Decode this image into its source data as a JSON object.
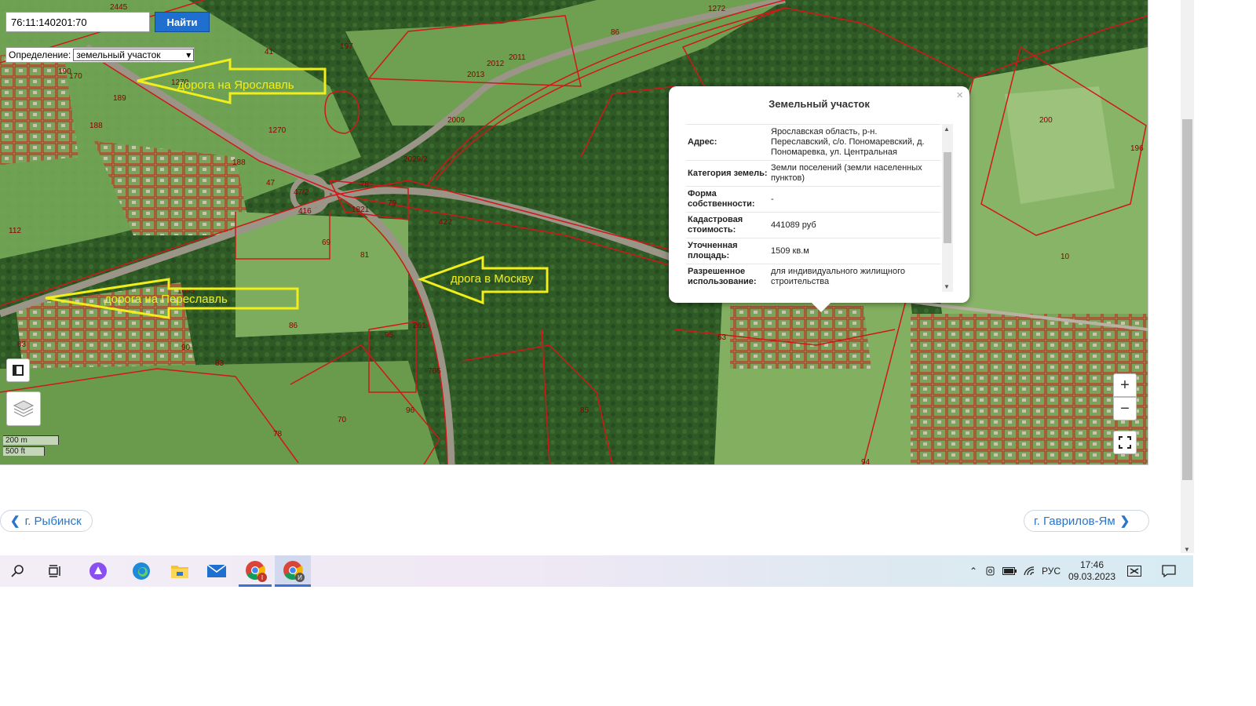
{
  "search": {
    "value": "76:11:140201:70",
    "button_label": "Найти"
  },
  "definition": {
    "label": "Определение:",
    "selected": "земельный участок"
  },
  "annotations": {
    "yaroslavl": "дорога на Ярославль",
    "pereslavl": "дорога на Переславль",
    "moscow": "дрога в Москву"
  },
  "plot_numbers": [
    "2445",
    "1272",
    "86",
    "197",
    "41",
    "2012",
    "2011",
    "190",
    "170",
    "1270",
    "2013",
    "189",
    "188",
    "1270",
    "2009",
    "2029/2",
    "200",
    "196",
    "188",
    "47",
    "47/2",
    "78",
    "1821",
    "79",
    "416",
    "112",
    "422",
    "69",
    "81",
    "10",
    "1695",
    "95",
    "83",
    "86",
    "90",
    "63",
    "261",
    "765",
    "83",
    "96",
    "85",
    "70",
    "78",
    "94"
  ],
  "popup": {
    "title": "Земельный участок",
    "close": "×",
    "rows": [
      {
        "key": "Адрес:",
        "value": "Ярославская область, р-н. Переславский, с/о. Пономаревский, д. Пономаревка, ул. Центральная"
      },
      {
        "key": "Категория земель:",
        "value": "Земли поселений (земли населенных пунктов)"
      },
      {
        "key": "Форма собственности:",
        "value": "-"
      },
      {
        "key": "Кадастровая стоимость:",
        "value": "441089 руб"
      },
      {
        "key": "Уточненная площадь:",
        "value": "1509 кв.м"
      },
      {
        "key": "Разрешенное использование:",
        "value": "для индивидуального жилищного строительства"
      }
    ]
  },
  "map_controls": {
    "zoom_in": "+",
    "zoom_out": "−"
  },
  "scale": {
    "metric": "200 m",
    "imperial": "500 ft"
  },
  "nav": {
    "prev": "г. Рыбинск",
    "next": "г. Гаврилов-Ям"
  },
  "taskbar": {
    "chrome1_badge": "I",
    "chrome2_badge": "И"
  },
  "tray": {
    "lang": "РУС",
    "time": "17:46",
    "date": "09.03.2023"
  }
}
